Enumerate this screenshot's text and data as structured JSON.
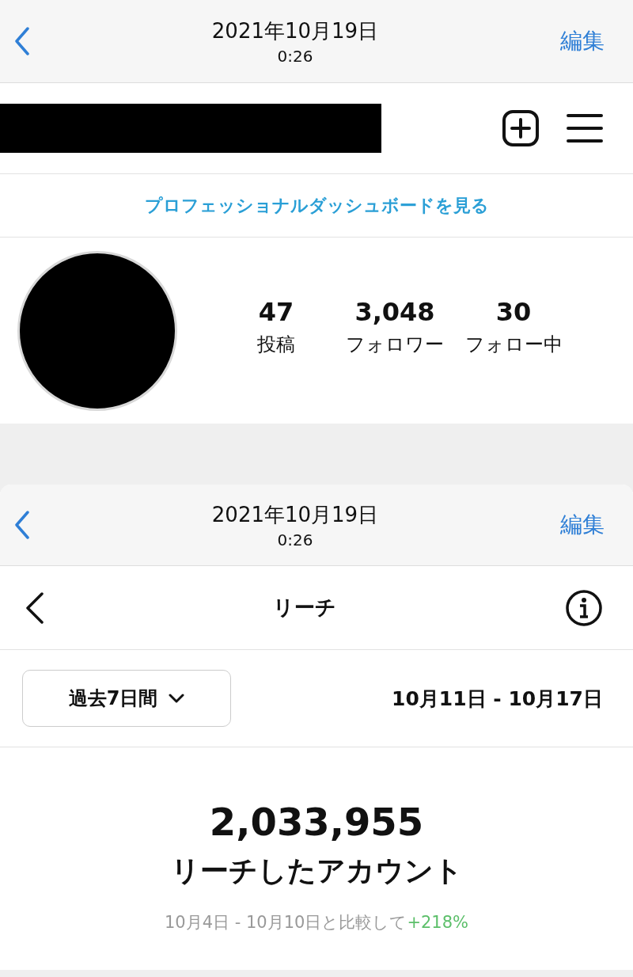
{
  "screens": [
    {
      "header": {
        "date": "2021年10月19日",
        "time": "0:26",
        "edit": "編集"
      },
      "profile": {
        "dashboard_link": "プロフェッショナルダッシュボードを見る",
        "stats": [
          {
            "value": "47",
            "label": "投稿"
          },
          {
            "value": "3,048",
            "label": "フォロワー"
          },
          {
            "value": "30",
            "label": "フォロー中"
          }
        ]
      }
    },
    {
      "header": {
        "date": "2021年10月19日",
        "time": "0:26",
        "edit": "編集"
      },
      "reach": {
        "title": "リーチ",
        "period": "過去7日間",
        "date_range": "10月11日 - 10月17日",
        "total": "2,033,955",
        "total_label": "リーチしたアカウント",
        "comparison": "10月4日 - 10月10日と比較して",
        "change": "+218%"
      }
    }
  ]
}
